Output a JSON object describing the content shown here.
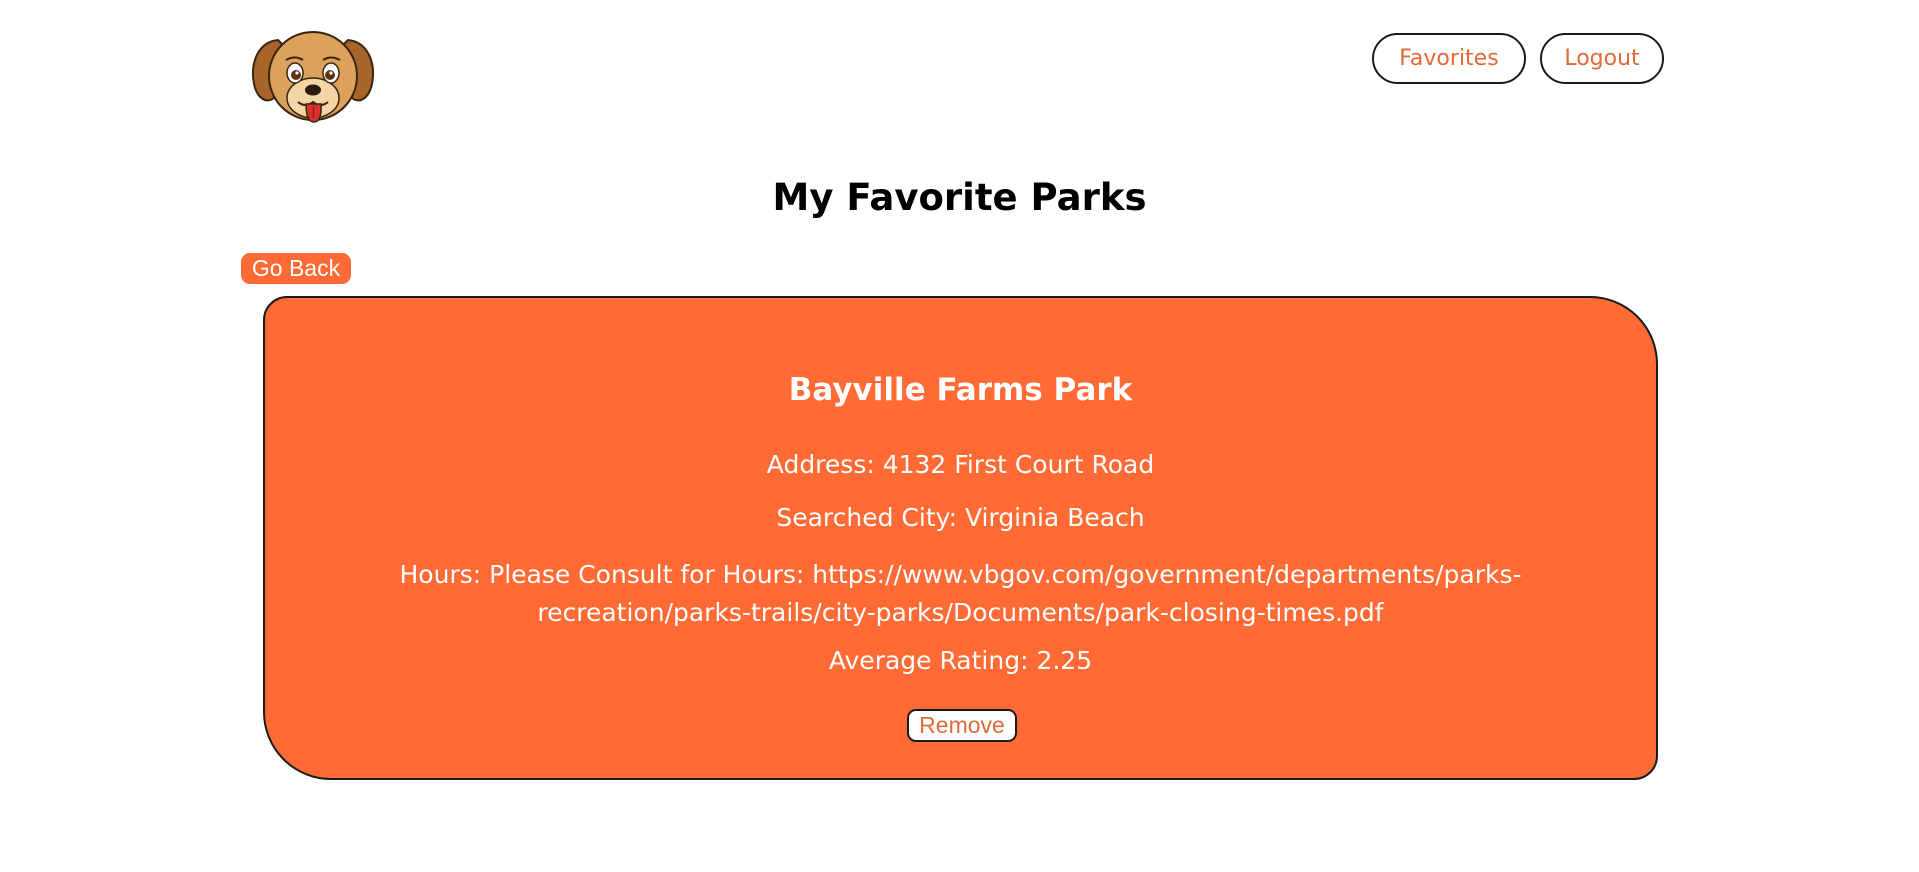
{
  "header": {
    "logo_icon": "dog-face-icon",
    "favorites_label": "Favorites",
    "logout_label": "Logout"
  },
  "page": {
    "title": "My Favorite Parks",
    "back_label": "Go Back"
  },
  "parks": [
    {
      "name": "Bayville Farms Park",
      "address": "Address: 4132 First Court Road",
      "city": "Searched City: Virginia Beach",
      "hours": "Hours: Please Consult for Hours: https://www.vbgov.com/government/departments/parks-recreation/parks-trails/city-parks/Documents/park-closing-times.pdf",
      "rating": "Average Rating: 2.25",
      "remove_label": "Remove"
    }
  ],
  "colors": {
    "accent": "#ff6a35",
    "button_text": "#e06a3a"
  }
}
